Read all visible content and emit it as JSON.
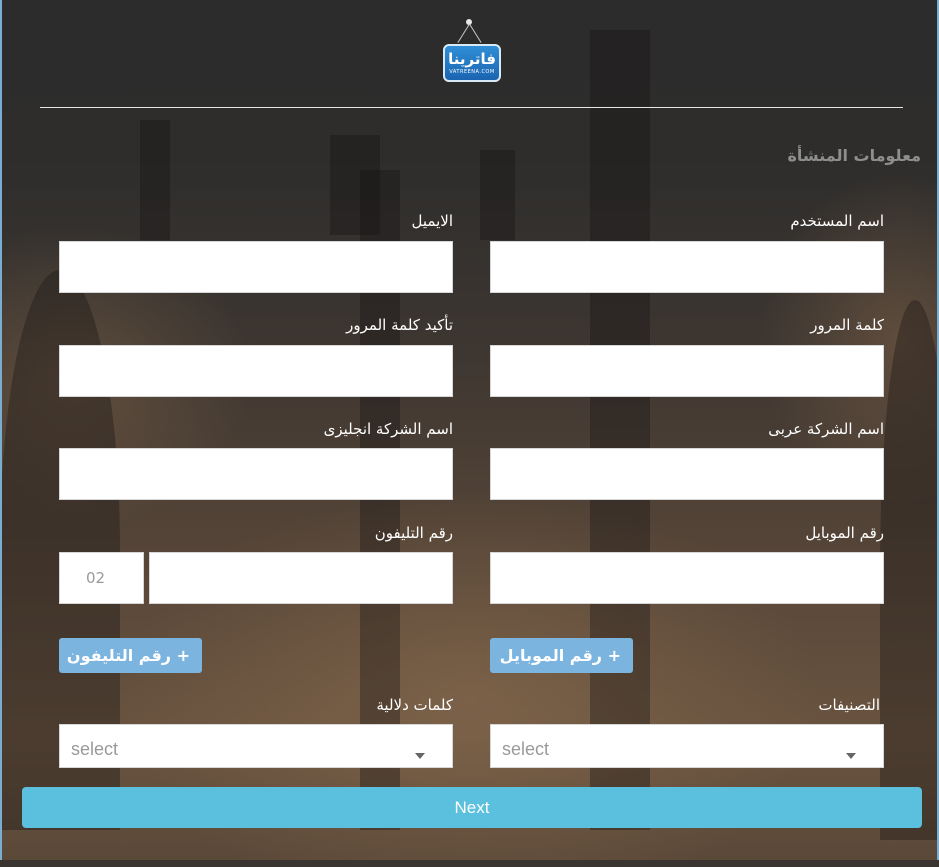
{
  "logo": {
    "text": "فاترينا",
    "sub": "VATREENA.COM"
  },
  "section_title": "معلومات المنشأة",
  "fields": {
    "username": {
      "label": "اسم المستخدم",
      "value": ""
    },
    "email": {
      "label": "الايميل",
      "value": ""
    },
    "password": {
      "label": "كلمة المرور",
      "value": ""
    },
    "confirm_password": {
      "label": "تأكيد كلمة المرور",
      "value": ""
    },
    "company_ar": {
      "label": "اسم الشركة عربى",
      "value": ""
    },
    "company_en": {
      "label": "اسم الشركة انجليزى",
      "value": ""
    },
    "mobile": {
      "label": "رقم الموبايل",
      "value": ""
    },
    "phone": {
      "label": "رقم التليفون",
      "value": "",
      "prefix": "02"
    }
  },
  "buttons": {
    "add_mobile": "+ رقم الموبايل",
    "add_phone": "+ رقم التليفون",
    "next": "Next"
  },
  "selects": {
    "categories": {
      "label": "التصنيفات",
      "value": "select"
    },
    "keywords": {
      "label": "كلمات دلالية",
      "value": "select"
    }
  },
  "colors": {
    "accent": "#5bc0de",
    "add_button": "#7cb4e0",
    "section_title": "#8e8e8e"
  }
}
